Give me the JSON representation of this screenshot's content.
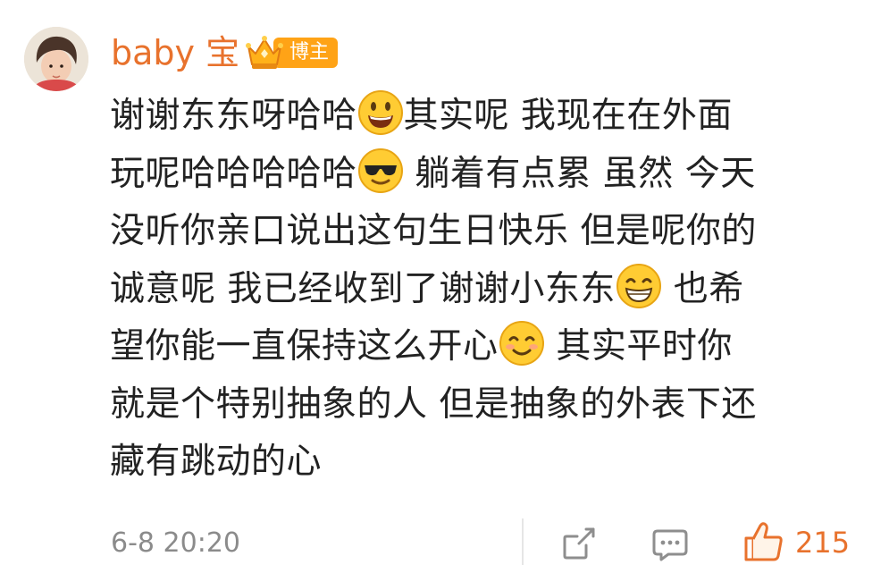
{
  "comment": {
    "username": "baby 宝",
    "badge_label": "博主",
    "lines": [
      {
        "segments": [
          {
            "text": "谢谢东东呀哈哈"
          },
          {
            "emoji": "smiley-face"
          },
          {
            "text": "其实呢 我现在在外面"
          }
        ]
      },
      {
        "segments": [
          {
            "text": "玩呢哈哈哈哈哈"
          },
          {
            "emoji": "sunglasses-face"
          },
          {
            "text": " 躺着有点累  虽然 今天"
          }
        ]
      },
      {
        "segments": [
          {
            "text": "没听你亲口说出这句生日快乐  但是呢你的"
          }
        ]
      },
      {
        "segments": [
          {
            "text": "诚意呢 我已经收到了谢谢小东东"
          },
          {
            "emoji": "grinning-face"
          },
          {
            "text": "  也希"
          }
        ]
      },
      {
        "segments": [
          {
            "text": "望你能一直保持这么开心"
          },
          {
            "emoji": "smiling-face"
          },
          {
            "text": " 其实平时你"
          }
        ]
      },
      {
        "segments": [
          {
            "text": "就是个特别抽象的人  但是抽象的外表下还"
          }
        ]
      },
      {
        "segments": [
          {
            "text": "藏有跳动的心"
          }
        ]
      }
    ],
    "timestamp": "6-8 20:20",
    "like_count": "215"
  },
  "colors": {
    "accent": "#e8722d",
    "badge": "#ffa316",
    "text": "#222222",
    "meta": "#8b8b8b"
  },
  "icons": {
    "badge": "crown-icon",
    "share": "share-icon",
    "comment": "comment-icon",
    "like": "thumbs-up-icon"
  }
}
